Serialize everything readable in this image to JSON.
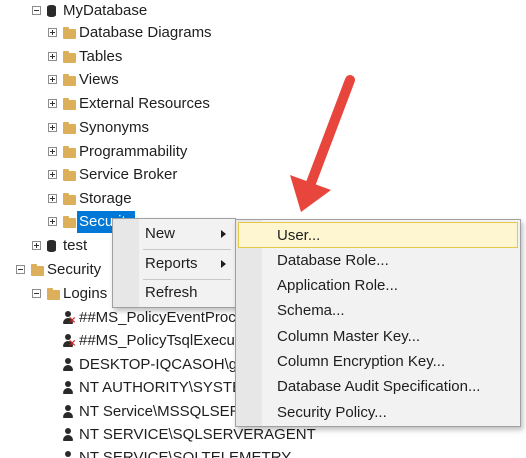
{
  "tree": {
    "database": "MyDatabase",
    "db_children": [
      "Database Diagrams",
      "Tables",
      "Views",
      "External Resources",
      "Synonyms",
      "Programmability",
      "Service Broker",
      "Storage",
      "Security"
    ],
    "other_db": "test",
    "security_folder": "Security",
    "logins_folder": "Logins",
    "logins": [
      "##MS_PolicyEventProce",
      "##MS_PolicyTsqlExecut",
      "DESKTOP-IQCASOH\\gr",
      "NT AUTHORITY\\SYSTEM",
      "NT Service\\MSSQLSERV",
      "NT SERVICE\\SQLSERVERAGENT",
      "NT SERVICE\\SQLTELEMETRY"
    ]
  },
  "context_menu": {
    "items": [
      "New",
      "Reports",
      "Refresh"
    ]
  },
  "new_submenu": {
    "items": [
      "User...",
      "Database Role...",
      "Application Role...",
      "Schema...",
      "Column Master Key...",
      "Column Encryption Key...",
      "Database Audit Specification...",
      "Security Policy..."
    ]
  },
  "colors": {
    "selection": "#0078d7",
    "hover": "#fdf6d0",
    "arrow": "#e8453c",
    "folder": "#dcb05a"
  }
}
